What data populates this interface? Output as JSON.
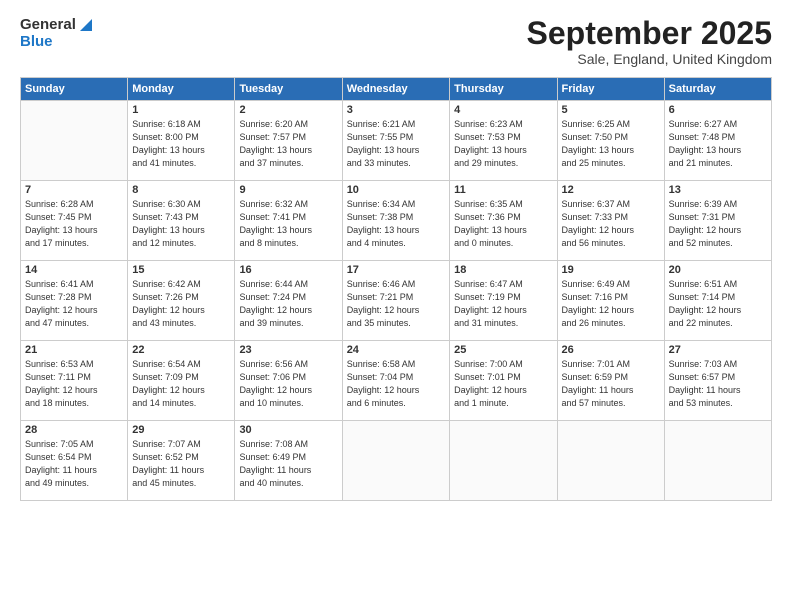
{
  "header": {
    "logo_general": "General",
    "logo_blue": "Blue",
    "title": "September 2025",
    "subtitle": "Sale, England, United Kingdom"
  },
  "days_of_week": [
    "Sunday",
    "Monday",
    "Tuesday",
    "Wednesday",
    "Thursday",
    "Friday",
    "Saturday"
  ],
  "weeks": [
    [
      {
        "day": "",
        "detail": ""
      },
      {
        "day": "1",
        "detail": "Sunrise: 6:18 AM\nSunset: 8:00 PM\nDaylight: 13 hours\nand 41 minutes."
      },
      {
        "day": "2",
        "detail": "Sunrise: 6:20 AM\nSunset: 7:57 PM\nDaylight: 13 hours\nand 37 minutes."
      },
      {
        "day": "3",
        "detail": "Sunrise: 6:21 AM\nSunset: 7:55 PM\nDaylight: 13 hours\nand 33 minutes."
      },
      {
        "day": "4",
        "detail": "Sunrise: 6:23 AM\nSunset: 7:53 PM\nDaylight: 13 hours\nand 29 minutes."
      },
      {
        "day": "5",
        "detail": "Sunrise: 6:25 AM\nSunset: 7:50 PM\nDaylight: 13 hours\nand 25 minutes."
      },
      {
        "day": "6",
        "detail": "Sunrise: 6:27 AM\nSunset: 7:48 PM\nDaylight: 13 hours\nand 21 minutes."
      }
    ],
    [
      {
        "day": "7",
        "detail": "Sunrise: 6:28 AM\nSunset: 7:45 PM\nDaylight: 13 hours\nand 17 minutes."
      },
      {
        "day": "8",
        "detail": "Sunrise: 6:30 AM\nSunset: 7:43 PM\nDaylight: 13 hours\nand 12 minutes."
      },
      {
        "day": "9",
        "detail": "Sunrise: 6:32 AM\nSunset: 7:41 PM\nDaylight: 13 hours\nand 8 minutes."
      },
      {
        "day": "10",
        "detail": "Sunrise: 6:34 AM\nSunset: 7:38 PM\nDaylight: 13 hours\nand 4 minutes."
      },
      {
        "day": "11",
        "detail": "Sunrise: 6:35 AM\nSunset: 7:36 PM\nDaylight: 13 hours\nand 0 minutes."
      },
      {
        "day": "12",
        "detail": "Sunrise: 6:37 AM\nSunset: 7:33 PM\nDaylight: 12 hours\nand 56 minutes."
      },
      {
        "day": "13",
        "detail": "Sunrise: 6:39 AM\nSunset: 7:31 PM\nDaylight: 12 hours\nand 52 minutes."
      }
    ],
    [
      {
        "day": "14",
        "detail": "Sunrise: 6:41 AM\nSunset: 7:28 PM\nDaylight: 12 hours\nand 47 minutes."
      },
      {
        "day": "15",
        "detail": "Sunrise: 6:42 AM\nSunset: 7:26 PM\nDaylight: 12 hours\nand 43 minutes."
      },
      {
        "day": "16",
        "detail": "Sunrise: 6:44 AM\nSunset: 7:24 PM\nDaylight: 12 hours\nand 39 minutes."
      },
      {
        "day": "17",
        "detail": "Sunrise: 6:46 AM\nSunset: 7:21 PM\nDaylight: 12 hours\nand 35 minutes."
      },
      {
        "day": "18",
        "detail": "Sunrise: 6:47 AM\nSunset: 7:19 PM\nDaylight: 12 hours\nand 31 minutes."
      },
      {
        "day": "19",
        "detail": "Sunrise: 6:49 AM\nSunset: 7:16 PM\nDaylight: 12 hours\nand 26 minutes."
      },
      {
        "day": "20",
        "detail": "Sunrise: 6:51 AM\nSunset: 7:14 PM\nDaylight: 12 hours\nand 22 minutes."
      }
    ],
    [
      {
        "day": "21",
        "detail": "Sunrise: 6:53 AM\nSunset: 7:11 PM\nDaylight: 12 hours\nand 18 minutes."
      },
      {
        "day": "22",
        "detail": "Sunrise: 6:54 AM\nSunset: 7:09 PM\nDaylight: 12 hours\nand 14 minutes."
      },
      {
        "day": "23",
        "detail": "Sunrise: 6:56 AM\nSunset: 7:06 PM\nDaylight: 12 hours\nand 10 minutes."
      },
      {
        "day": "24",
        "detail": "Sunrise: 6:58 AM\nSunset: 7:04 PM\nDaylight: 12 hours\nand 6 minutes."
      },
      {
        "day": "25",
        "detail": "Sunrise: 7:00 AM\nSunset: 7:01 PM\nDaylight: 12 hours\nand 1 minute."
      },
      {
        "day": "26",
        "detail": "Sunrise: 7:01 AM\nSunset: 6:59 PM\nDaylight: 11 hours\nand 57 minutes."
      },
      {
        "day": "27",
        "detail": "Sunrise: 7:03 AM\nSunset: 6:57 PM\nDaylight: 11 hours\nand 53 minutes."
      }
    ],
    [
      {
        "day": "28",
        "detail": "Sunrise: 7:05 AM\nSunset: 6:54 PM\nDaylight: 11 hours\nand 49 minutes."
      },
      {
        "day": "29",
        "detail": "Sunrise: 7:07 AM\nSunset: 6:52 PM\nDaylight: 11 hours\nand 45 minutes."
      },
      {
        "day": "30",
        "detail": "Sunrise: 7:08 AM\nSunset: 6:49 PM\nDaylight: 11 hours\nand 40 minutes."
      },
      {
        "day": "",
        "detail": ""
      },
      {
        "day": "",
        "detail": ""
      },
      {
        "day": "",
        "detail": ""
      },
      {
        "day": "",
        "detail": ""
      }
    ]
  ]
}
